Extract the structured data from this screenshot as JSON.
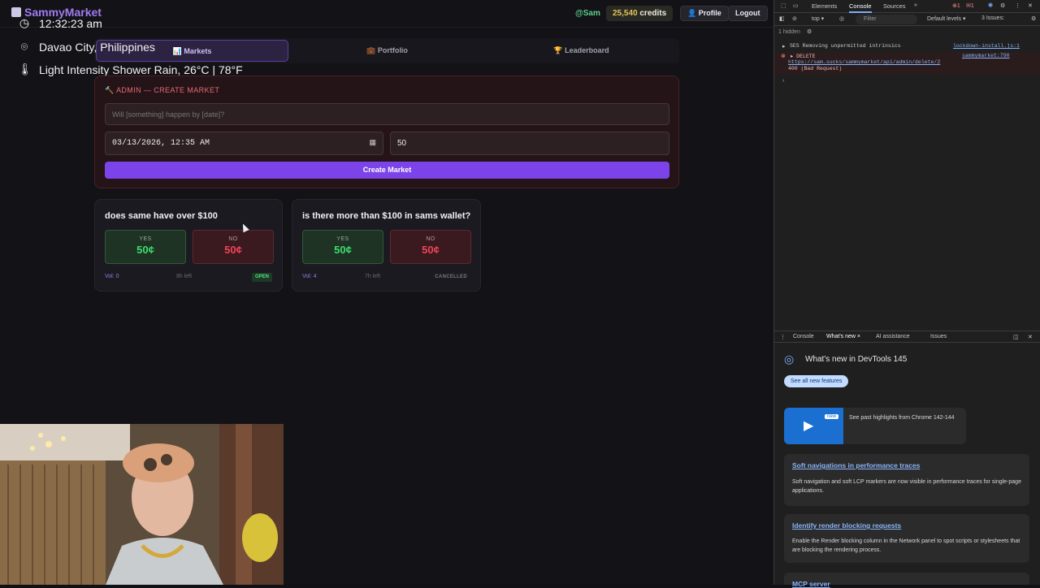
{
  "app": {
    "brand": "SammyMarket",
    "user_handle": "@Sam",
    "credits_value": "25,540",
    "credits_label": "credits",
    "profile_label": "👤 Profile",
    "logout_label": "Logout"
  },
  "overlay": {
    "time": "12:32:23 am",
    "location": "Davao City, Philippines",
    "weather": "Light Intensity Shower Rain, 26°C | 78°F"
  },
  "tabs": [
    {
      "label": "📊 Markets",
      "active": true
    },
    {
      "label": "💼 Portfolio",
      "active": false
    },
    {
      "label": "🏆 Leaderboard",
      "active": false
    }
  ],
  "admin": {
    "title": "🔨 ADMIN — CREATE MARKET",
    "question_placeholder": "Will [something] happen by [date]?",
    "date_value": "03/13/2026, 12:35 AM",
    "liquidity_value": "50",
    "create_label": "Create Market"
  },
  "markets": [
    {
      "question": "does same have over $100",
      "yes_label": "YES",
      "yes_price": "50¢",
      "no_label": "NO",
      "no_price": "50¢",
      "volume": "Vol: 0",
      "time_left": "8h left",
      "status": "OPEN"
    },
    {
      "question": "is there more than $100 in sams wallet?",
      "yes_label": "YES",
      "yes_price": "50¢",
      "no_label": "NO",
      "no_price": "50¢",
      "volume": "Vol: 4",
      "time_left": "7h left",
      "status": "CANCELLED"
    }
  ],
  "devtools": {
    "tabs": [
      "Elements",
      "Console",
      "Sources"
    ],
    "context": "top ▾",
    "filter_placeholder": "Filter",
    "levels": "Default levels ▾",
    "issues": "3 Issues:",
    "hidden": "1 hidden",
    "log1": "SES Removing unpermitted intrinsics",
    "log1_src": "lockdown-install.js:1",
    "err_method": "▸ DELETE",
    "err_url": "https://sam.sucks/sammymarket/api/admin/delete/2",
    "err_status": "400 (Bad Request)",
    "err_src": "sammymarket:790",
    "drawer_tabs": [
      "Console",
      "What's new ×",
      "AI assistance",
      "Issues"
    ],
    "whats_new_title": "What's new in DevTools 145",
    "see_all": "See all new features",
    "highlights_badge": "new",
    "highlights_text": "See past highlights from Chrome 142-144",
    "items": [
      {
        "title": "Soft navigations in performance traces",
        "desc": "Soft navigation and soft LCP markers are now visible in performance traces for single-page applications."
      },
      {
        "title": "Identify render blocking requests",
        "desc": "Enable the Render blocking column in the Network panel to spot scripts or stylesheets that are blocking the rendering process."
      },
      {
        "title": "MCP server",
        "desc": ""
      }
    ]
  }
}
